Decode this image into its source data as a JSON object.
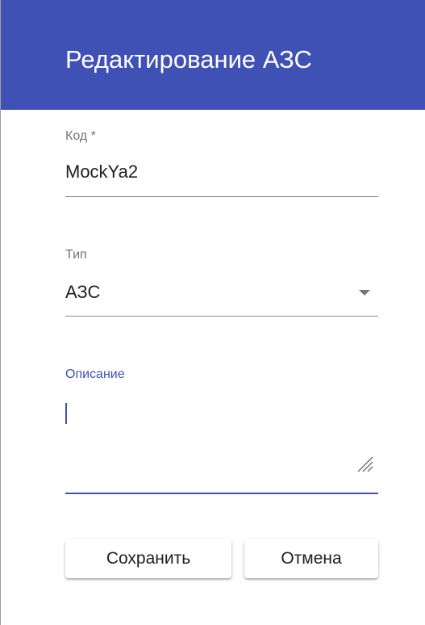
{
  "dialog": {
    "title": "Редактирование АЗС",
    "header_color": "#3f51b5",
    "accent_color": "#3f51b5"
  },
  "fields": {
    "code": {
      "label": "Код *",
      "value": "MockYa2"
    },
    "type": {
      "label": "Тип",
      "value": "АЗС",
      "icon": "dropdown-arrow-icon"
    },
    "description": {
      "label": "Описание",
      "value": "",
      "state": "focused",
      "icon": "resize-handle-icon"
    }
  },
  "actions": {
    "save_label": "Сохранить",
    "cancel_label": "Отмена"
  }
}
